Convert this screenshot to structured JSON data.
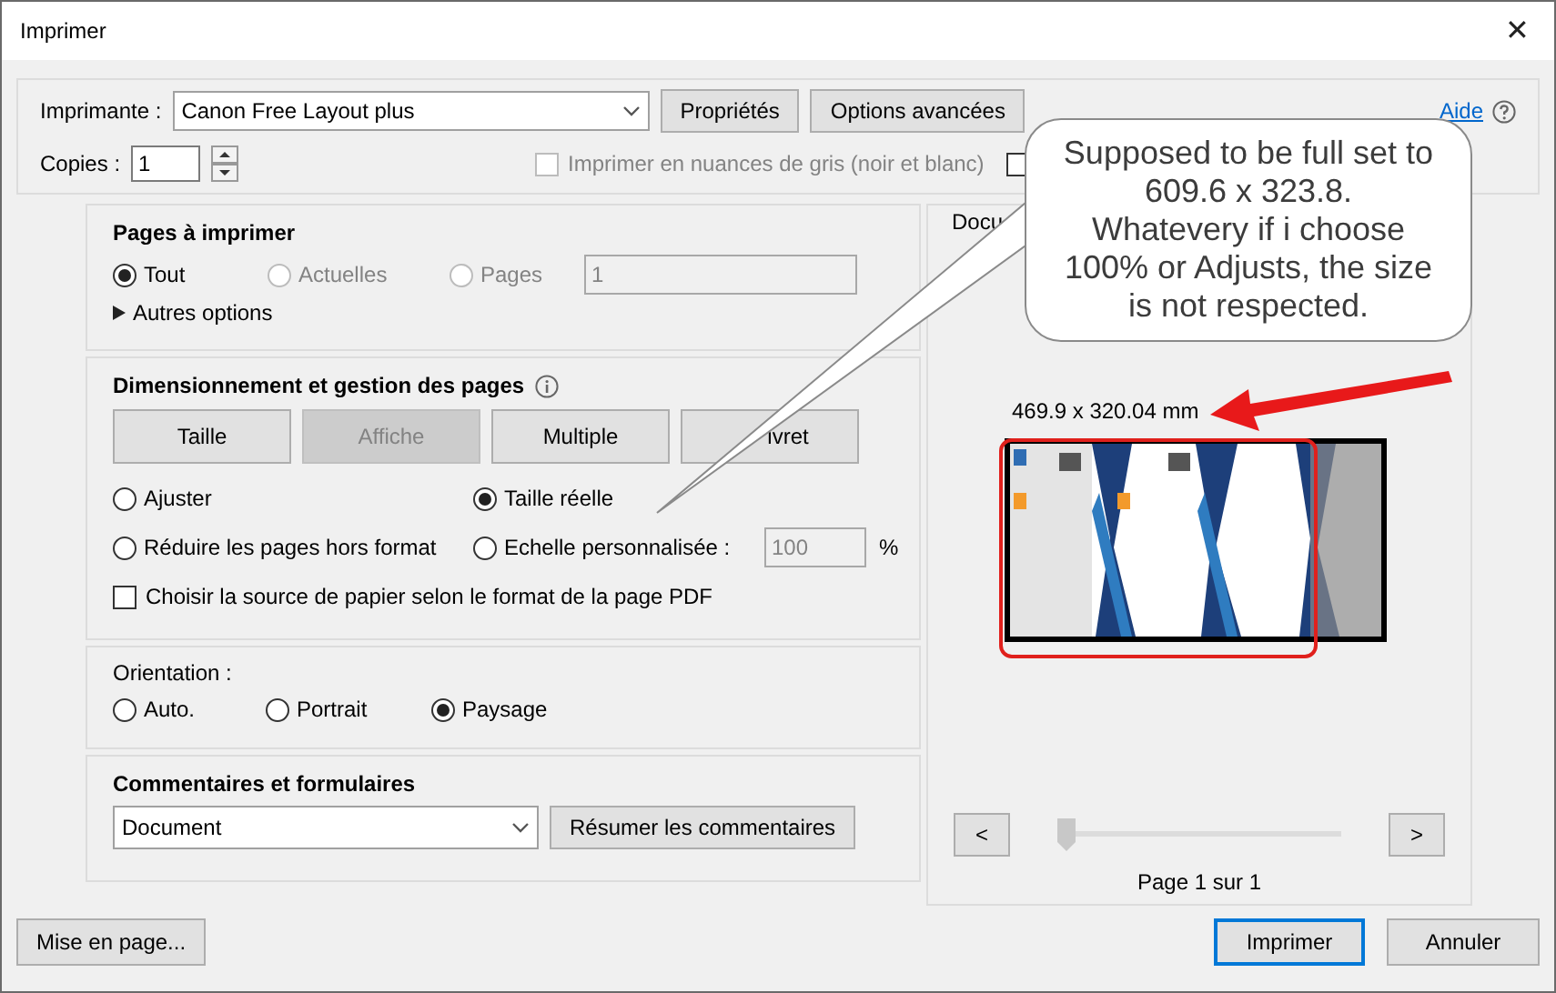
{
  "window": {
    "title": "Imprimer",
    "close": "✕"
  },
  "printer": {
    "label": "Imprimante :",
    "value": "Canon Free Layout plus",
    "buttons": [
      "Propriétés",
      "Options avancées"
    ],
    "help": "Aide"
  },
  "copies": {
    "label": "Copies :",
    "value": "1"
  },
  "checkboxes": [
    {
      "label": "Imprimer en nuances de gris (noir et blanc)",
      "checked": false,
      "disabled": true
    },
    {
      "checked": false,
      "disabled": false
    }
  ],
  "pages": {
    "title": "Pages à imprimer",
    "options": [
      {
        "label": "Tout",
        "selected": true,
        "disabled": false
      },
      {
        "label": "Actuelles",
        "selected": false,
        "disabled": true
      },
      {
        "label": "Pages",
        "selected": false,
        "disabled": true
      }
    ],
    "range": "1",
    "more": {
      "label": "Autres options",
      "expanded": false
    }
  },
  "sizing": {
    "title": "Dimensionnement et gestion des pages",
    "modes": [
      {
        "label": "Taille",
        "disabled": false
      },
      {
        "label": "Affiche",
        "disabled": true
      },
      {
        "label": "Multiple",
        "disabled": false
      },
      {
        "label": "ivret",
        "disabled": false
      }
    ],
    "options": [
      {
        "label": "Ajuster",
        "selected": false
      },
      {
        "label": "Taille réelle",
        "selected": true
      },
      {
        "label": "Réduire les pages hors format",
        "selected": false
      },
      {
        "label": "Echelle personnalisée :",
        "selected": false
      }
    ],
    "scale": "100",
    "unit": "%",
    "paper_source": {
      "label": "Choisir la source de papier selon le format de la page PDF",
      "checked": false
    }
  },
  "orientation": {
    "title": "Orientation :",
    "options": [
      {
        "label": "Auto.",
        "selected": false
      },
      {
        "label": "Portrait",
        "selected": false
      },
      {
        "label": "Paysage",
        "selected": true
      }
    ]
  },
  "comments": {
    "title": "Commentaires et formulaires",
    "value": "Document",
    "button": "Résumer les commentaires"
  },
  "preview": {
    "title": "Docu",
    "size": "469.9 x 320.04 mm",
    "prev": "<",
    "next": ">",
    "slider": {
      "level": 0
    },
    "page": "Page 1 sur 1"
  },
  "footer": {
    "setup": "Mise en page...",
    "print": "Imprimer",
    "cancel": "Annuler"
  },
  "annotation": {
    "text": "Supposed to be full set to 609.6 x 323.8. Whatevery if i choose 100% or Adjusts, the size is not respected."
  }
}
